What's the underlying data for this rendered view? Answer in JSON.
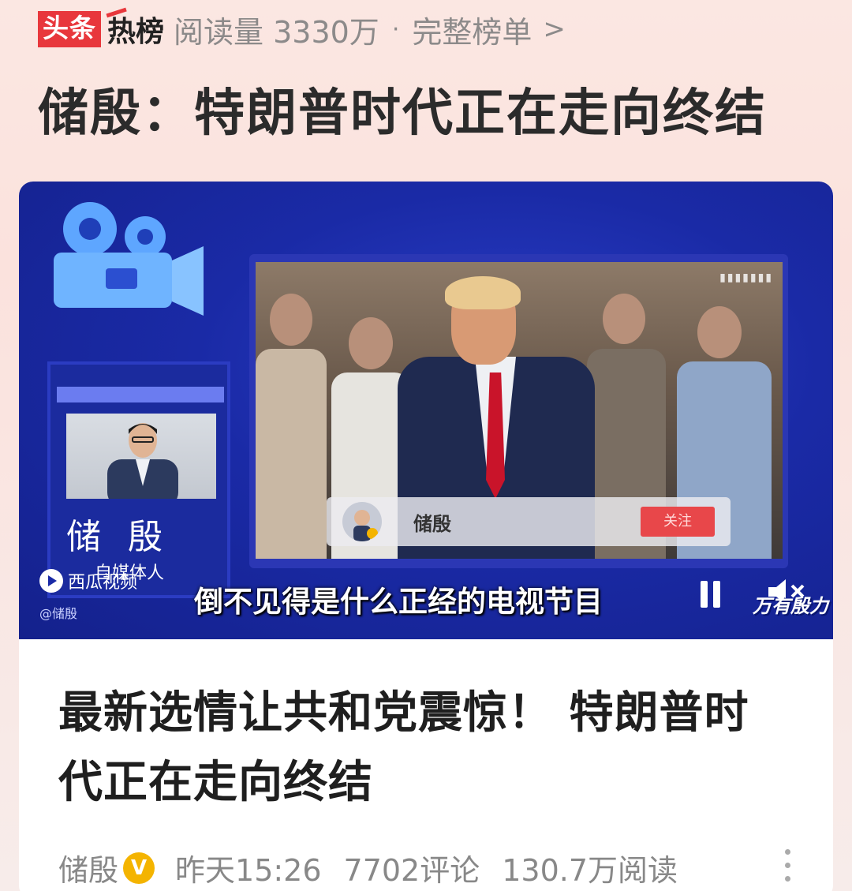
{
  "header": {
    "brand_left": "头条",
    "brand_right": "热榜",
    "read_count": "阅读量 3330万",
    "separator": "·",
    "full_list": "完整榜单",
    "chevron": ">"
  },
  "headline": "储殷：特朗普时代正在走向终结",
  "video": {
    "host_name": "储 殷",
    "host_title": "自媒体人",
    "platform": "西瓜视频",
    "watermark": "@储殷",
    "inner_follow_name": "储殷",
    "inner_follow_button": "关注",
    "subtitle": "倒不见得是什么正经的电视节目",
    "channel_logo": "万有殷力",
    "state": "playing",
    "icons": [
      "camera-icon",
      "pause-icon",
      "mute-icon",
      "xigua-logo-icon"
    ]
  },
  "article": {
    "title": "最新选情让共和党震惊！ 特朗普时代正在走向终结",
    "author": "储殷",
    "verified_badge": "V",
    "time": "昨天15:26",
    "comments": "7702评论",
    "reads": "130.7万阅读"
  },
  "colors": {
    "brand_red": "#e8373c",
    "video_blue": "#1a2aa6",
    "accent_yellow": "#f5d33a",
    "verified_gold": "#f4b400"
  }
}
